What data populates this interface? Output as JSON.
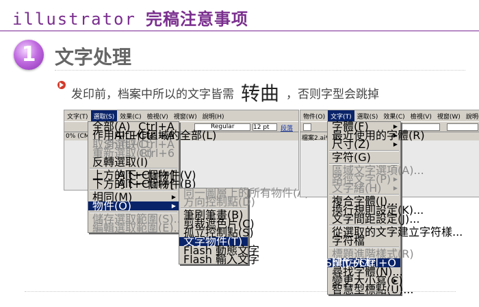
{
  "header": {
    "title_en": "illustrator",
    "title_cn": "完稿注意事项"
  },
  "section": {
    "number": "1",
    "title": "文字处理"
  },
  "instruction": {
    "part1": "发印前，档案中所以的文字皆需",
    "emphasis": "转曲",
    "part2": "，否则字型会跳掉"
  },
  "shot1": {
    "menubar": [
      "文字(T)",
      "選取(S)",
      "效果(C)",
      "檢視(V)",
      "視窗(W)",
      "說明(H)"
    ],
    "toolbar_font_style": "Regular",
    "toolbar_font_size": "12 pt",
    "toolbar_link": "段落",
    "doc_tab": "0% (CMY",
    "select_menu": [
      {
        "label": "全部(A)",
        "shortcut": "Ctrl+A",
        "disabled": false
      },
      {
        "label": "作用中工作區域的全部(L)",
        "shortcut": "Alt+Ctrl+A",
        "disabled": false
      },
      {
        "label": "取消選取(D)",
        "shortcut": "Shift+Ctrl+A",
        "disabled": true
      },
      {
        "label": "重新選取(R)",
        "shortcut": "Ctrl+6",
        "disabled": true
      },
      {
        "label": "反轉選取(I)",
        "shortcut": "",
        "disabled": false
      },
      {
        "sep": true
      },
      {
        "label": "上方的下一個物件(V)",
        "shortcut": "Alt+Ctrl+]",
        "disabled": false
      },
      {
        "label": "下方的下一個物件(B)",
        "shortcut": "Alt+Ctrl+[",
        "disabled": false
      },
      {
        "sep": true
      },
      {
        "label": "相同(M)",
        "shortcut": "",
        "disabled": false,
        "submenu": true
      },
      {
        "label": "物件(O)",
        "shortcut": "",
        "disabled": false,
        "submenu": true,
        "highlight": true
      },
      {
        "sep": true
      },
      {
        "label": "儲存選取範圍(S)...",
        "shortcut": "",
        "disabled": true
      },
      {
        "label": "編輯選取範圍(E)...",
        "shortcut": "",
        "disabled": true
      }
    ],
    "object_submenu": [
      {
        "label": "同一圖層上的所有物件(A)",
        "disabled": true
      },
      {
        "label": "方向控制點(D)",
        "disabled": true
      },
      {
        "sep": true
      },
      {
        "label": "筆刷筆畫(B)",
        "disabled": false
      },
      {
        "label": "剪裁遮色片(C)",
        "disabled": false
      },
      {
        "label": "孤立控制點(S)",
        "disabled": false
      },
      {
        "label": "文字物件(T)",
        "disabled": false,
        "highlight": true
      },
      {
        "label": "Flash 動態文字",
        "disabled": false
      },
      {
        "label": "Flash 輸入文字",
        "disabled": false
      }
    ]
  },
  "shot2": {
    "menubar": [
      "物件(O)",
      "文字(T)",
      "選取(S)",
      "效果(C)",
      "檢視(V)",
      "視窗(W)",
      "說明(H)"
    ],
    "doc_tab": "檔案2.ai* @",
    "type_menu": [
      {
        "label": "字體(F)",
        "shortcut": "",
        "disabled": false,
        "submenu": true
      },
      {
        "label": "最近使用的字體(R)",
        "shortcut": "",
        "disabled": false,
        "submenu": true
      },
      {
        "label": "尺寸(Z)",
        "shortcut": "",
        "disabled": false,
        "submenu": true
      },
      {
        "sep": true
      },
      {
        "label": "字符(G)",
        "shortcut": "",
        "disabled": false
      },
      {
        "sep": true
      },
      {
        "label": "區域文字選項(A)...",
        "shortcut": "",
        "disabled": true
      },
      {
        "label": "路徑文字(P)",
        "shortcut": "",
        "disabled": true,
        "submenu": true
      },
      {
        "label": "文字緒(H)",
        "shortcut": "",
        "disabled": true,
        "submenu": true
      },
      {
        "sep": true
      },
      {
        "label": "複合字體(I)...",
        "shortcut": "",
        "disabled": false
      },
      {
        "label": "換行規則設定(K)...",
        "shortcut": "",
        "disabled": false
      },
      {
        "label": "文字間距設定(J)...",
        "shortcut": "",
        "disabled": false
      },
      {
        "sep": true
      },
      {
        "label": "從選取的文字建立字符樣...",
        "shortcut": "",
        "disabled": false
      },
      {
        "label": "字符檔",
        "shortcut": "",
        "disabled": false
      },
      {
        "sep": true
      },
      {
        "label": "標題進階樣式(R)",
        "shortcut": "",
        "disabled": true
      },
      {
        "label": "建立外框",
        "shortcut": "Shift+Ctrl+O",
        "disabled": false,
        "highlight": true
      },
      {
        "label": "尋找字體(N)...",
        "shortcut": "",
        "disabled": false
      },
      {
        "label": "變更大小寫(C)",
        "shortcut": "",
        "disabled": false,
        "submenu": true
      },
      {
        "label": "智慧型標點(U)...",
        "shortcut": "",
        "disabled": false
      }
    ]
  }
}
